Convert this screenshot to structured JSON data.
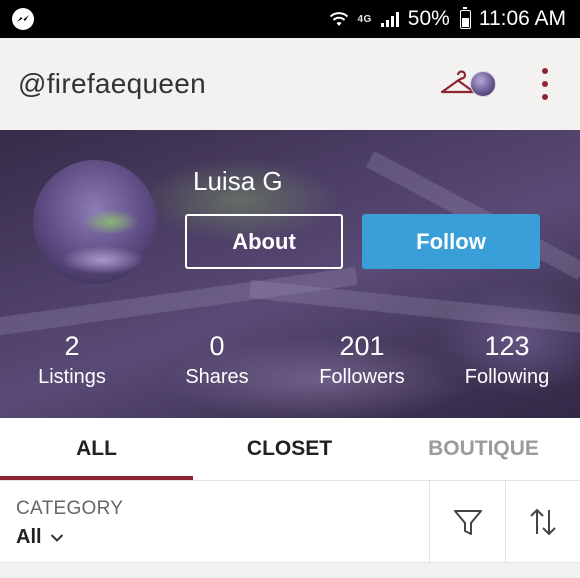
{
  "status_bar": {
    "network": "4G",
    "battery": "50%",
    "time": "11:06 AM"
  },
  "header": {
    "username": "@firefaequeen"
  },
  "profile": {
    "display_name": "Luisa G",
    "about_label": "About",
    "follow_label": "Follow",
    "stats": [
      {
        "value": "2",
        "label": "Listings"
      },
      {
        "value": "0",
        "label": "Shares"
      },
      {
        "value": "201",
        "label": "Followers"
      },
      {
        "value": "123",
        "label": "Following"
      }
    ]
  },
  "tabs": [
    {
      "label": "ALL",
      "active": true
    },
    {
      "label": "CLOSET",
      "active": false
    },
    {
      "label": "BOUTIQUE",
      "active": false
    }
  ],
  "filter_bar": {
    "category_label": "CATEGORY",
    "category_value": "All"
  },
  "colors": {
    "accent": "#8b2433",
    "follow_blue": "#3a9fd8"
  },
  "icons": [
    "messenger-icon",
    "wifi-icon",
    "signal-icon",
    "battery-icon",
    "hanger-icon",
    "overflow-menu-icon",
    "chevron-down-icon",
    "filter-icon",
    "sort-icon"
  ]
}
